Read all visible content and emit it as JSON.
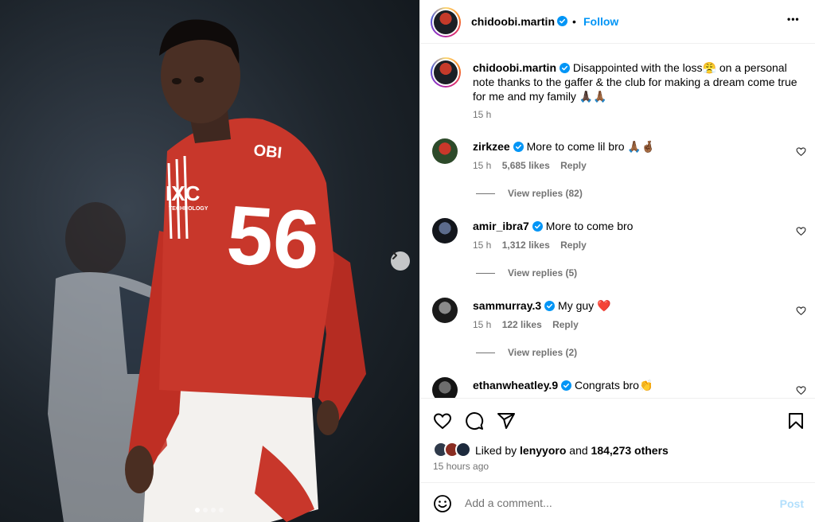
{
  "post": {
    "author": "chidoobi.martin",
    "follow_label": "Follow",
    "more_label": "•••",
    "jersey_name": "OBI",
    "jersey_number": "56",
    "sponsor": "IXC",
    "sponsor_sub": "TECHNOLOGY",
    "image_count": 4,
    "active_image_index": 0
  },
  "caption": {
    "username": "chidoobi.martin",
    "text": "Disappointed with the loss😤 on a personal note thanks to the gaffer & the club for making a dream come true for me and my family 🙏🏿🙏🏾",
    "time": "15 h"
  },
  "comments": [
    {
      "username": "zirkzee",
      "text": "More to come lil bro 🙏🏾🤞🏾",
      "time": "15 h",
      "likes": "5,685 likes",
      "reply_label": "Reply",
      "view_replies": "View replies (82)"
    },
    {
      "username": "amir_ibra7",
      "text": "More to come bro",
      "time": "15 h",
      "likes": "1,312 likes",
      "reply_label": "Reply",
      "view_replies": "View replies (5)"
    },
    {
      "username": "sammurray.3",
      "text": "My guy ❤️",
      "time": "15 h",
      "likes": "122 likes",
      "reply_label": "Reply",
      "view_replies": "View replies (2)"
    },
    {
      "username": "ethanwheatley.9",
      "text": "Congrats bro👏",
      "time": "",
      "likes": "",
      "reply_label": "",
      "view_replies": ""
    }
  ],
  "likes": {
    "prefix": "Liked by",
    "user": "lenyyoro",
    "joiner": "and",
    "others": "184,273 others",
    "posted": "15 hours ago"
  },
  "add_comment": {
    "placeholder": "Add a comment...",
    "post_label": "Post"
  },
  "colors": {
    "accent": "#0095f6",
    "verified": "#0095f6",
    "muted": "#737373",
    "post_disabled": "#b2dffc",
    "jersey_red": "#c8372b"
  },
  "icons": [
    "verified-badge-icon",
    "more-options-icon",
    "heart-icon",
    "comment-icon",
    "share-icon",
    "bookmark-icon",
    "emoji-icon",
    "chevron-right-icon"
  ]
}
